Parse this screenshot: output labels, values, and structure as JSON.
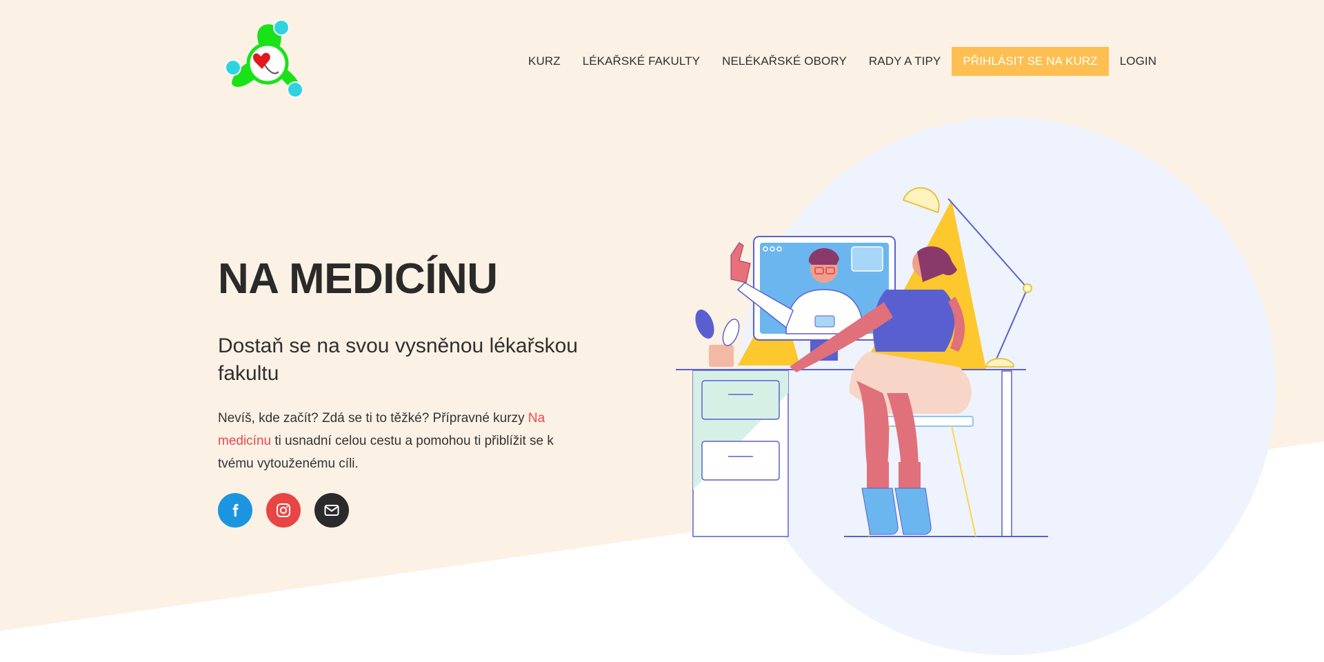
{
  "colors": {
    "page_bg": "#fbf1e4",
    "circle": "#eef3fd",
    "accent_cta": "#fdbf52",
    "highlight": "#e8484f",
    "facebook": "#1b95e0",
    "instagram": "#e84545",
    "email": "#2b2b2b"
  },
  "header": {
    "logo_icon": "heart-medicine-logo-icon",
    "nav": [
      {
        "label": "KURZ"
      },
      {
        "label": "LÉKAŘSKÉ FAKULTY"
      },
      {
        "label": "NELÉKAŘSKÉ OBORY"
      },
      {
        "label": "RADY A TIPY"
      },
      {
        "label": "PŘIHLÁSIT SE NA KURZ"
      },
      {
        "label": "LOGIN"
      }
    ]
  },
  "hero": {
    "title": "NA MEDICÍNU",
    "subtitle": "Dostaň se na svou vysněnou lékařskou fakultu",
    "text_before": "Nevíš, kde začít? Zdá se ti to těžké? Přípravné kurzy ",
    "text_highlight": "Na medicínu",
    "text_after": " ti usnadní celou cestu a pomohou ti přiblížit se k tvému vytouženému cíli.",
    "illustration_icon": "online-consultation-illustration"
  },
  "social": [
    {
      "icon": "facebook-icon"
    },
    {
      "icon": "instagram-icon"
    },
    {
      "icon": "envelope-icon"
    }
  ]
}
